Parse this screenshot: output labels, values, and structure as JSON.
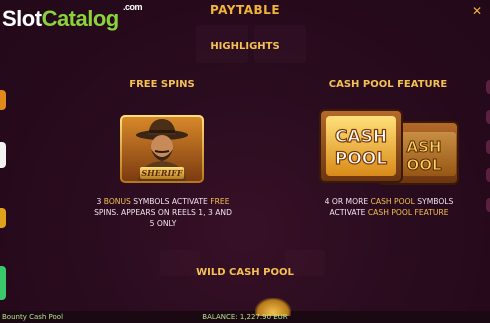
{
  "header": {
    "title": "PAYTABLE",
    "close_icon": "close-icon"
  },
  "logo": {
    "part1": "Slot",
    "part2": "Catalog",
    "suffix": ".com"
  },
  "section": {
    "title": "HIGHLIGHTS"
  },
  "free_spins": {
    "title": "FREE SPINS",
    "symbol_label": "SHERIFF",
    "desc_count": "3",
    "desc_symbol": "BONUS",
    "desc_rest": "SYMBOLS ACTIVATE",
    "desc_free": "FREE",
    "desc_line2": "SPINS. APPEARS ON REELS 1, 3 AND",
    "desc_line3": "5 ONLY"
  },
  "cash_pool": {
    "title": "CASH POOL FEATURE",
    "symbol_line1": "CASH",
    "symbol_line2": "POOL",
    "symbol_back1": "ASH",
    "symbol_back2": "OOL",
    "desc_start": "4 OR MORE",
    "desc_hl": "CASH POOL",
    "desc_end": "SYMBOLS",
    "desc_line2_start": "ACTIVATE",
    "desc_line2_hl": "CASH POOL FEATURE"
  },
  "wild": {
    "title": "WILD CASH POOL"
  },
  "footer": {
    "game_name": "Bounty Cash Pool",
    "balance": "BALANCE: 1,227.90 EUR"
  },
  "colors": {
    "accent": "#f4c152",
    "background": "#2a0f1e",
    "logo_green": "#8bd33a",
    "footer_text": "#b5e08c"
  }
}
